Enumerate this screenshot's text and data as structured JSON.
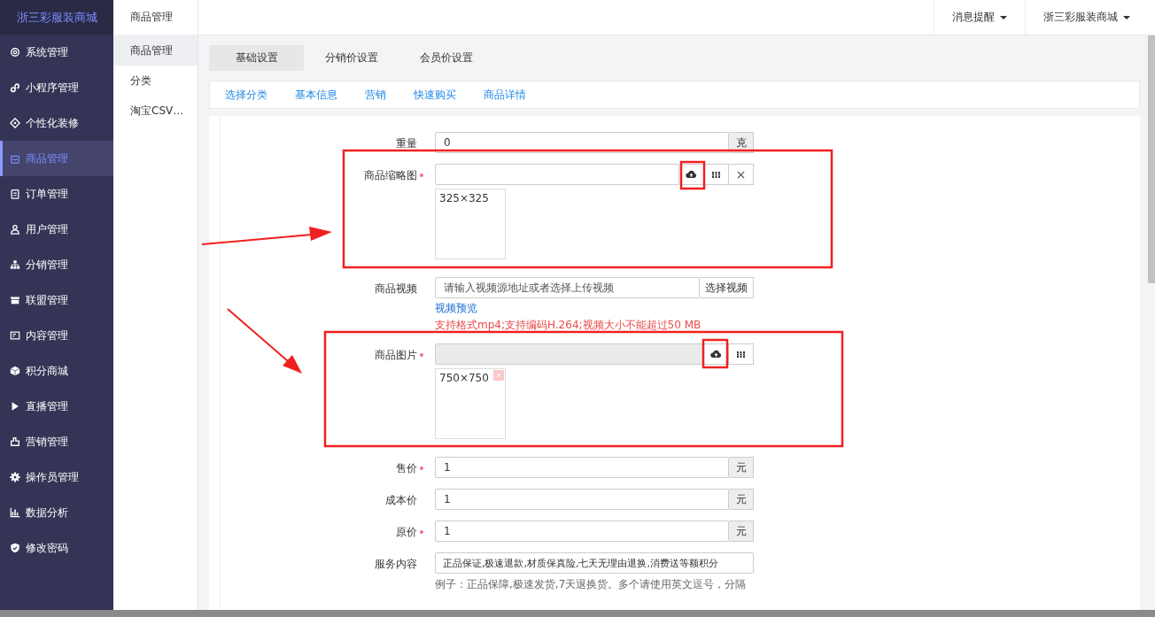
{
  "brand": "浙三彩服装商城",
  "sidebar": [
    {
      "label": "系统管理",
      "selected": false
    },
    {
      "label": "小程序管理",
      "selected": false
    },
    {
      "label": "个性化装修",
      "selected": false
    },
    {
      "label": "商品管理",
      "selected": true
    },
    {
      "label": "订单管理",
      "selected": false
    },
    {
      "label": "用户管理",
      "selected": false
    },
    {
      "label": "分销管理",
      "selected": false
    },
    {
      "label": "联盟管理",
      "selected": false
    },
    {
      "label": "内容管理",
      "selected": false
    },
    {
      "label": "积分商城",
      "selected": false
    },
    {
      "label": "直播管理",
      "selected": false
    },
    {
      "label": "营销管理",
      "selected": false
    },
    {
      "label": "操作员管理",
      "selected": false
    },
    {
      "label": "数据分析",
      "selected": false
    },
    {
      "label": "修改密码",
      "selected": false
    }
  ],
  "subnav": {
    "title": "商品管理",
    "items": [
      {
        "label": "商品管理",
        "selected": true
      },
      {
        "label": "分类",
        "selected": false
      },
      {
        "label": "淘宝CSV…",
        "selected": false
      }
    ]
  },
  "topbar": {
    "menus": [
      "消息提醒",
      "浙三彩服装商城"
    ]
  },
  "tabs": [
    {
      "label": "基础设置",
      "selected": true
    },
    {
      "label": "分销价设置",
      "selected": false
    },
    {
      "label": "会员价设置",
      "selected": false
    }
  ],
  "section_links": [
    "选择分类",
    "基本信息",
    "营销",
    "快速购买",
    "商品详情"
  ],
  "form": [
    {
      "kind": "addon",
      "label": "重量",
      "required": false,
      "value": "0",
      "addon": "克"
    },
    {
      "kind": "upload",
      "label": "商品缩略图",
      "required": true,
      "disabled": false,
      "clearable": true,
      "size": "325×325",
      "removable": false
    },
    {
      "kind": "video",
      "label": "商品视频",
      "placeholder": "请输入视频源地址或者选择上传视频",
      "button": "选择视频",
      "link": "视频预览",
      "hint": "支持格式mp4;支持编码H.264;视频大小不能超过50 MB"
    },
    {
      "kind": "upload",
      "label": "商品图片",
      "required": true,
      "disabled": true,
      "clearable": false,
      "size": "750×750",
      "removable": true
    },
    {
      "kind": "addon",
      "label": "售价",
      "required": true,
      "value": "1",
      "addon": "元"
    },
    {
      "kind": "addon",
      "label": "成本价",
      "required": false,
      "value": "1",
      "addon": "元"
    },
    {
      "kind": "addon",
      "label": "原价",
      "required": true,
      "value": "1",
      "addon": "元"
    },
    {
      "kind": "text",
      "label": "服务内容",
      "value": "正品保证,极速退款,材质保真险,七天无理由退换,消费送等额积分",
      "hint": "例子：正品保障,极速发货,7天退换货。多个请使用英文逗号，分隔"
    }
  ]
}
